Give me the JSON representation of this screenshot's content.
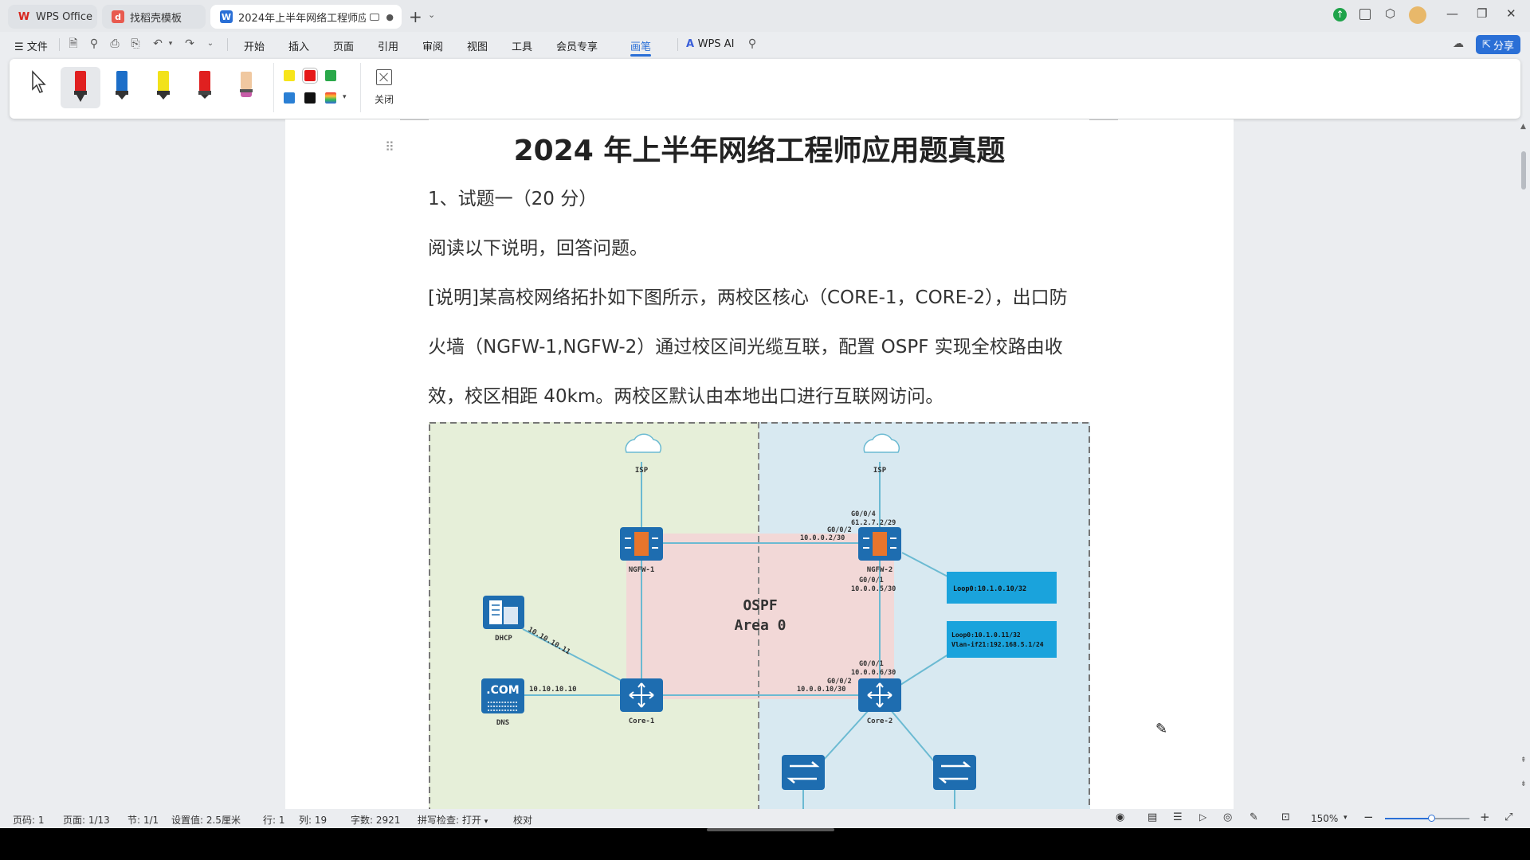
{
  "tabs": [
    {
      "label": "WPS Office",
      "icon": "wps-logo-icon"
    },
    {
      "label": "找稻壳模板",
      "icon": "docer-icon"
    },
    {
      "label": "2024年上半年网络工程师应用",
      "icon": "word-doc-icon",
      "active": true
    }
  ],
  "menu": {
    "file": "文件",
    "items": [
      "开始",
      "插入",
      "页面",
      "引用",
      "审阅",
      "视图",
      "工具",
      "会员专享",
      "画笔"
    ],
    "active": "画笔",
    "wps_ai": "WPS AI",
    "share": "分享"
  },
  "ribbon": {
    "close_label": "关闭",
    "pen_colors": [
      "#e02020",
      "#1c6ec8",
      "#f2e21a",
      "#e02020",
      "#f0c8a0"
    ],
    "swatches": [
      "#f7e51a",
      "#e61919",
      "#2aa84a",
      "#2a7fd4",
      "#111111"
    ]
  },
  "document": {
    "title": "2024 年上半年网络工程师应用题真题",
    "lines": [
      "1、试题一（20 分）",
      "阅读以下说明，回答问题。",
      "[说明]某高校网络拓扑如下图所示，两校区核心（CORE-1，CORE-2），出口防",
      "火墙（NGFW-1,NGFW-2）通过校区间光缆互联，配置 OSPF 实现全校路由收",
      "效，校区相距 40km。两校区默认由本地出口进行互联网访问。"
    ]
  },
  "diagram": {
    "isp_left": "ISP",
    "isp_right": "ISP",
    "ngfw1": "NGFW-1",
    "ngfw2": "NGFW-2",
    "core1": "Core-1",
    "core2": "Core-2",
    "dhcp": "DHCP",
    "dns": "DNS",
    "dns_badge": ".COM",
    "ospf": "OSPF",
    "area": "Area 0",
    "dhcp_ip": "10.10.10.11",
    "dns_ip": "10.10.10.10",
    "ngfw2_g004": "G0/0/4",
    "ngfw2_g004_ip": "61.2.7.2/29",
    "ngfw2_g002": "G0/0/2",
    "ngfw2_g002_ip": "10.0.0.2/30",
    "ngfw2_g001": "G0/0/1",
    "ngfw2_g001_ip": "10.0.0.5/30",
    "core2_g001": "G0/0/1",
    "core2_g001_ip": "10.0.0.6/30",
    "core2_g002": "G0/0/2",
    "core2_g002_ip": "10.0.0.10/30",
    "callout1": "Loop0:10.1.0.10/32",
    "callout2_line1": "Loop0:10.1.0.11/32",
    "callout2_line2": "Vlan-if21:192.168.5.1/24"
  },
  "status": {
    "page_code": "页码: 1",
    "page": "页面: 1/13",
    "section": "节: 1/1",
    "setting": "设置值: 2.5厘米",
    "row": "行: 1",
    "col": "列: 19",
    "word_count": "字数: 2921",
    "spell": "拼写检查: 打开",
    "proof": "校对",
    "zoom": "150%"
  }
}
